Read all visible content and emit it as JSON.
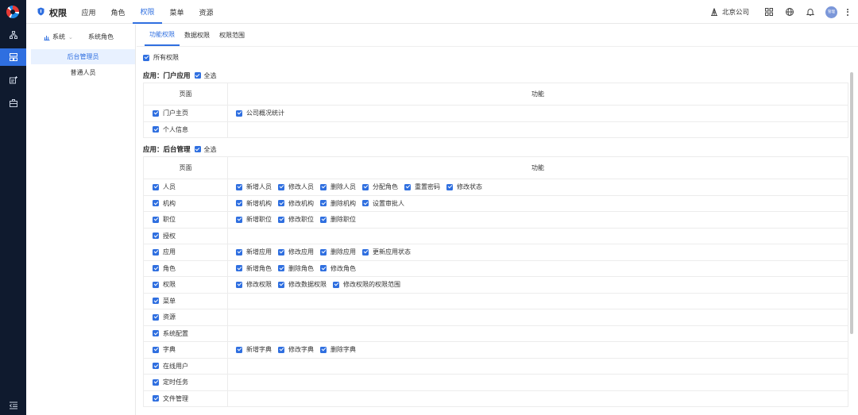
{
  "app": {
    "title": "权限"
  },
  "top_nav": [
    {
      "label": "应用",
      "active": false
    },
    {
      "label": "角色",
      "active": false
    },
    {
      "label": "权限",
      "active": true
    },
    {
      "label": "菜单",
      "active": false
    },
    {
      "label": "资源",
      "active": false
    }
  ],
  "top_right": {
    "company": "北京公司",
    "avatar_text": "管理"
  },
  "sidepanel": {
    "system_label": "系统",
    "roles_header": "系统角色",
    "roles": [
      {
        "label": "后台管理员",
        "active": true
      },
      {
        "label": "普通人员",
        "active": false
      }
    ]
  },
  "sub_tabs": [
    {
      "label": "功能权限",
      "active": true
    },
    {
      "label": "数据权限",
      "active": false
    },
    {
      "label": "权限范围",
      "active": false
    }
  ],
  "all_permissions_label": "所有权限",
  "select_all_label": "全选",
  "table_headers": {
    "page": "页面",
    "function": "功能"
  },
  "sections": [
    {
      "title": "应用：门户应用",
      "rows": [
        {
          "page": "门户主页",
          "functions": [
            "公司概况统计"
          ]
        },
        {
          "page": "个人信息",
          "functions": []
        }
      ]
    },
    {
      "title": "应用：后台管理",
      "rows": [
        {
          "page": "人员",
          "functions": [
            "新增人员",
            "修改人员",
            "删除人员",
            "分配角色",
            "重置密码",
            "修改状态"
          ]
        },
        {
          "page": "机构",
          "functions": [
            "新增机构",
            "修改机构",
            "删除机构",
            "设置审批人"
          ]
        },
        {
          "page": "职位",
          "functions": [
            "新增职位",
            "修改职位",
            "删除职位"
          ]
        },
        {
          "page": "授权",
          "functions": []
        },
        {
          "page": "应用",
          "functions": [
            "新增应用",
            "修改应用",
            "删除应用",
            "更新应用状态"
          ]
        },
        {
          "page": "角色",
          "functions": [
            "新增角色",
            "删除角色",
            "修改角色"
          ]
        },
        {
          "page": "权限",
          "functions": [
            "修改权限",
            "修改数据权限",
            "修改权限的权限范围"
          ]
        },
        {
          "page": "菜单",
          "functions": []
        },
        {
          "page": "资源",
          "functions": []
        },
        {
          "page": "系统配置",
          "functions": []
        },
        {
          "page": "字典",
          "functions": [
            "新增字典",
            "修改字典",
            "删除字典"
          ]
        },
        {
          "page": "在线用户",
          "functions": []
        },
        {
          "page": "定时任务",
          "functions": []
        },
        {
          "page": "文件管理",
          "functions": []
        }
      ]
    }
  ],
  "colors": {
    "accent": "#2f6fe0",
    "rail": "#0f1a2e",
    "selected_bg": "#e8f1ff"
  }
}
